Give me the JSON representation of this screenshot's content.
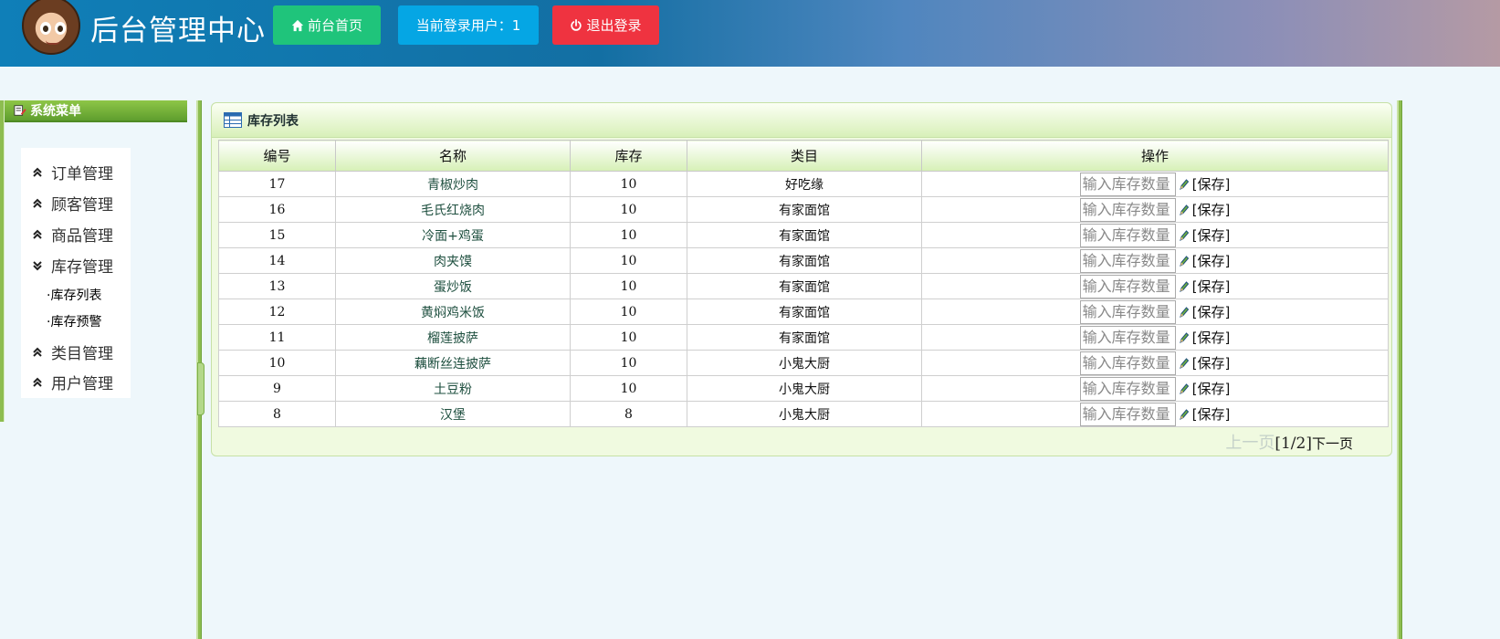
{
  "header": {
    "title": "后台管理中心",
    "home_button": "前台首页",
    "current_user": "当前登录用户：1",
    "logout_button": "退出登录"
  },
  "sidebar": {
    "title": "系统菜单",
    "menu": [
      {
        "label": "订单管理",
        "icon": "chevron-up-icon"
      },
      {
        "label": "顾客管理",
        "icon": "chevron-up-icon"
      },
      {
        "label": "商品管理",
        "icon": "chevron-up-icon"
      },
      {
        "label": "库存管理",
        "icon": "chevron-down-icon"
      },
      {
        "label": "类目管理",
        "icon": "chevron-up-icon"
      },
      {
        "label": "用户管理",
        "icon": "chevron-up-icon"
      }
    ],
    "submenu": [
      "·库存列表",
      "·库存预警"
    ]
  },
  "panel": {
    "title": "库存列表",
    "columns": [
      "编号",
      "名称",
      "库存",
      "类目",
      "操作"
    ],
    "input_placeholder": "输入库存数量",
    "save_label": "[保存]",
    "rows": [
      {
        "id": "17",
        "name": "青椒炒肉",
        "stock": "10",
        "category": "好吃缘"
      },
      {
        "id": "16",
        "name": "毛氏红烧肉",
        "stock": "10",
        "category": "有家面馆"
      },
      {
        "id": "15",
        "name": "冷面+鸡蛋",
        "stock": "10",
        "category": "有家面馆"
      },
      {
        "id": "14",
        "name": "肉夹馍",
        "stock": "10",
        "category": "有家面馆"
      },
      {
        "id": "13",
        "name": "蛋炒饭",
        "stock": "10",
        "category": "有家面馆"
      },
      {
        "id": "12",
        "name": "黄焖鸡米饭",
        "stock": "10",
        "category": "有家面馆"
      },
      {
        "id": "11",
        "name": "榴莲披萨",
        "stock": "10",
        "category": "有家面馆"
      },
      {
        "id": "10",
        "name": "藕断丝连披萨",
        "stock": "10",
        "category": "小鬼大厨"
      },
      {
        "id": "9",
        "name": "土豆粉",
        "stock": "10",
        "category": "小鬼大厨"
      },
      {
        "id": "8",
        "name": "汉堡",
        "stock": "8",
        "category": "小鬼大厨"
      }
    ],
    "pager": {
      "prev": "上一页",
      "info": "[1/2]",
      "next": "下一页"
    }
  }
}
